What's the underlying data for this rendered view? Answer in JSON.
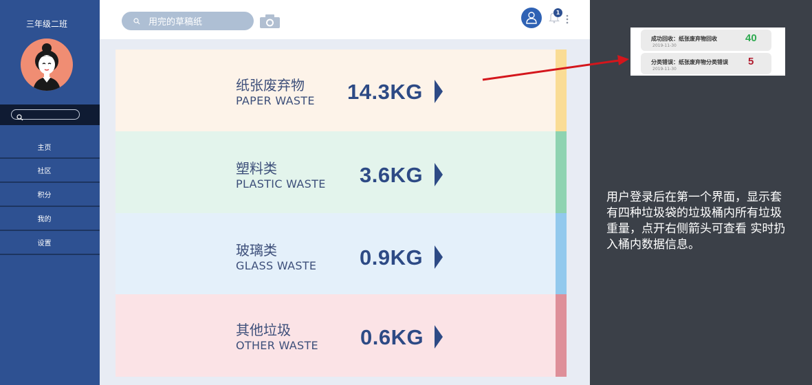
{
  "sidebar": {
    "class_name": "三年级二班",
    "nav_items": [
      "主页",
      "社区",
      "积分",
      "我的",
      "设置"
    ]
  },
  "header": {
    "search_text": "用完的草稿纸",
    "notification_count": "1"
  },
  "bins": [
    {
      "name_zh": "纸张废弃物",
      "name_en": "PAPER WASTE",
      "weight": "14.3KG",
      "bg": "#fdf3e9",
      "stripe": "#fadc95"
    },
    {
      "name_zh": "塑料类",
      "name_en": "PLASTIC WASTE",
      "weight": "3.6KG",
      "bg": "#e3f4ec",
      "stripe": "#8ed3b1"
    },
    {
      "name_zh": "玻璃类",
      "name_en": "GLASS WASTE",
      "weight": "0.9KG",
      "bg": "#e4f0fa",
      "stripe": "#92c9ed"
    },
    {
      "name_zh": "其他垃圾",
      "name_en": "OTHER WASTE",
      "weight": "0.6KG",
      "bg": "#fbe3e6",
      "stripe": "#de8f99"
    }
  ],
  "popup": {
    "items": [
      {
        "text": "成功回收：纸张废弃物回收",
        "date": "2019-11-30",
        "count": "40",
        "color": "#2eaa50"
      },
      {
        "text": "分类错误：纸张废弃物分类错误",
        "date": "2019-11-30",
        "count": "5",
        "color": "#b01c2e"
      }
    ]
  },
  "description": "用户登录后在第一个界面，显示套有四种垃圾袋的垃圾桶内所有垃圾重量，点开右侧箭头可查看 实时扔入桶内数据信息。"
}
